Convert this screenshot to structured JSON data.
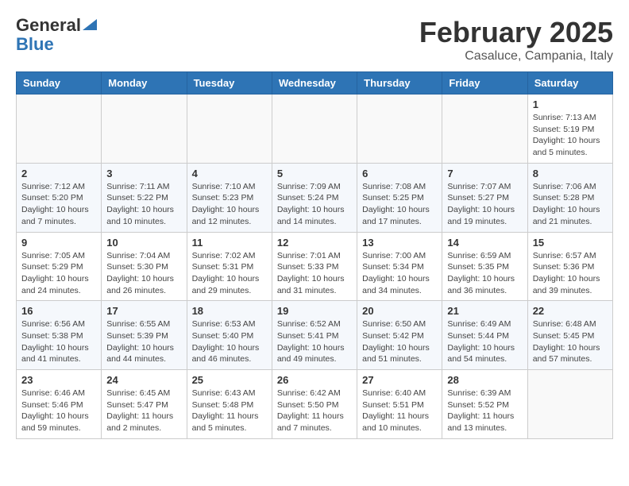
{
  "header": {
    "logo_line1": "General",
    "logo_line2": "Blue",
    "month_title": "February 2025",
    "location": "Casaluce, Campania, Italy"
  },
  "days_of_week": [
    "Sunday",
    "Monday",
    "Tuesday",
    "Wednesday",
    "Thursday",
    "Friday",
    "Saturday"
  ],
  "weeks": [
    [
      {
        "day": "",
        "info": ""
      },
      {
        "day": "",
        "info": ""
      },
      {
        "day": "",
        "info": ""
      },
      {
        "day": "",
        "info": ""
      },
      {
        "day": "",
        "info": ""
      },
      {
        "day": "",
        "info": ""
      },
      {
        "day": "1",
        "info": "Sunrise: 7:13 AM\nSunset: 5:19 PM\nDaylight: 10 hours\nand 5 minutes."
      }
    ],
    [
      {
        "day": "2",
        "info": "Sunrise: 7:12 AM\nSunset: 5:20 PM\nDaylight: 10 hours\nand 7 minutes."
      },
      {
        "day": "3",
        "info": "Sunrise: 7:11 AM\nSunset: 5:22 PM\nDaylight: 10 hours\nand 10 minutes."
      },
      {
        "day": "4",
        "info": "Sunrise: 7:10 AM\nSunset: 5:23 PM\nDaylight: 10 hours\nand 12 minutes."
      },
      {
        "day": "5",
        "info": "Sunrise: 7:09 AM\nSunset: 5:24 PM\nDaylight: 10 hours\nand 14 minutes."
      },
      {
        "day": "6",
        "info": "Sunrise: 7:08 AM\nSunset: 5:25 PM\nDaylight: 10 hours\nand 17 minutes."
      },
      {
        "day": "7",
        "info": "Sunrise: 7:07 AM\nSunset: 5:27 PM\nDaylight: 10 hours\nand 19 minutes."
      },
      {
        "day": "8",
        "info": "Sunrise: 7:06 AM\nSunset: 5:28 PM\nDaylight: 10 hours\nand 21 minutes."
      }
    ],
    [
      {
        "day": "9",
        "info": "Sunrise: 7:05 AM\nSunset: 5:29 PM\nDaylight: 10 hours\nand 24 minutes."
      },
      {
        "day": "10",
        "info": "Sunrise: 7:04 AM\nSunset: 5:30 PM\nDaylight: 10 hours\nand 26 minutes."
      },
      {
        "day": "11",
        "info": "Sunrise: 7:02 AM\nSunset: 5:31 PM\nDaylight: 10 hours\nand 29 minutes."
      },
      {
        "day": "12",
        "info": "Sunrise: 7:01 AM\nSunset: 5:33 PM\nDaylight: 10 hours\nand 31 minutes."
      },
      {
        "day": "13",
        "info": "Sunrise: 7:00 AM\nSunset: 5:34 PM\nDaylight: 10 hours\nand 34 minutes."
      },
      {
        "day": "14",
        "info": "Sunrise: 6:59 AM\nSunset: 5:35 PM\nDaylight: 10 hours\nand 36 minutes."
      },
      {
        "day": "15",
        "info": "Sunrise: 6:57 AM\nSunset: 5:36 PM\nDaylight: 10 hours\nand 39 minutes."
      }
    ],
    [
      {
        "day": "16",
        "info": "Sunrise: 6:56 AM\nSunset: 5:38 PM\nDaylight: 10 hours\nand 41 minutes."
      },
      {
        "day": "17",
        "info": "Sunrise: 6:55 AM\nSunset: 5:39 PM\nDaylight: 10 hours\nand 44 minutes."
      },
      {
        "day": "18",
        "info": "Sunrise: 6:53 AM\nSunset: 5:40 PM\nDaylight: 10 hours\nand 46 minutes."
      },
      {
        "day": "19",
        "info": "Sunrise: 6:52 AM\nSunset: 5:41 PM\nDaylight: 10 hours\nand 49 minutes."
      },
      {
        "day": "20",
        "info": "Sunrise: 6:50 AM\nSunset: 5:42 PM\nDaylight: 10 hours\nand 51 minutes."
      },
      {
        "day": "21",
        "info": "Sunrise: 6:49 AM\nSunset: 5:44 PM\nDaylight: 10 hours\nand 54 minutes."
      },
      {
        "day": "22",
        "info": "Sunrise: 6:48 AM\nSunset: 5:45 PM\nDaylight: 10 hours\nand 57 minutes."
      }
    ],
    [
      {
        "day": "23",
        "info": "Sunrise: 6:46 AM\nSunset: 5:46 PM\nDaylight: 10 hours\nand 59 minutes."
      },
      {
        "day": "24",
        "info": "Sunrise: 6:45 AM\nSunset: 5:47 PM\nDaylight: 11 hours\nand 2 minutes."
      },
      {
        "day": "25",
        "info": "Sunrise: 6:43 AM\nSunset: 5:48 PM\nDaylight: 11 hours\nand 5 minutes."
      },
      {
        "day": "26",
        "info": "Sunrise: 6:42 AM\nSunset: 5:50 PM\nDaylight: 11 hours\nand 7 minutes."
      },
      {
        "day": "27",
        "info": "Sunrise: 6:40 AM\nSunset: 5:51 PM\nDaylight: 11 hours\nand 10 minutes."
      },
      {
        "day": "28",
        "info": "Sunrise: 6:39 AM\nSunset: 5:52 PM\nDaylight: 11 hours\nand 13 minutes."
      },
      {
        "day": "",
        "info": ""
      }
    ]
  ]
}
